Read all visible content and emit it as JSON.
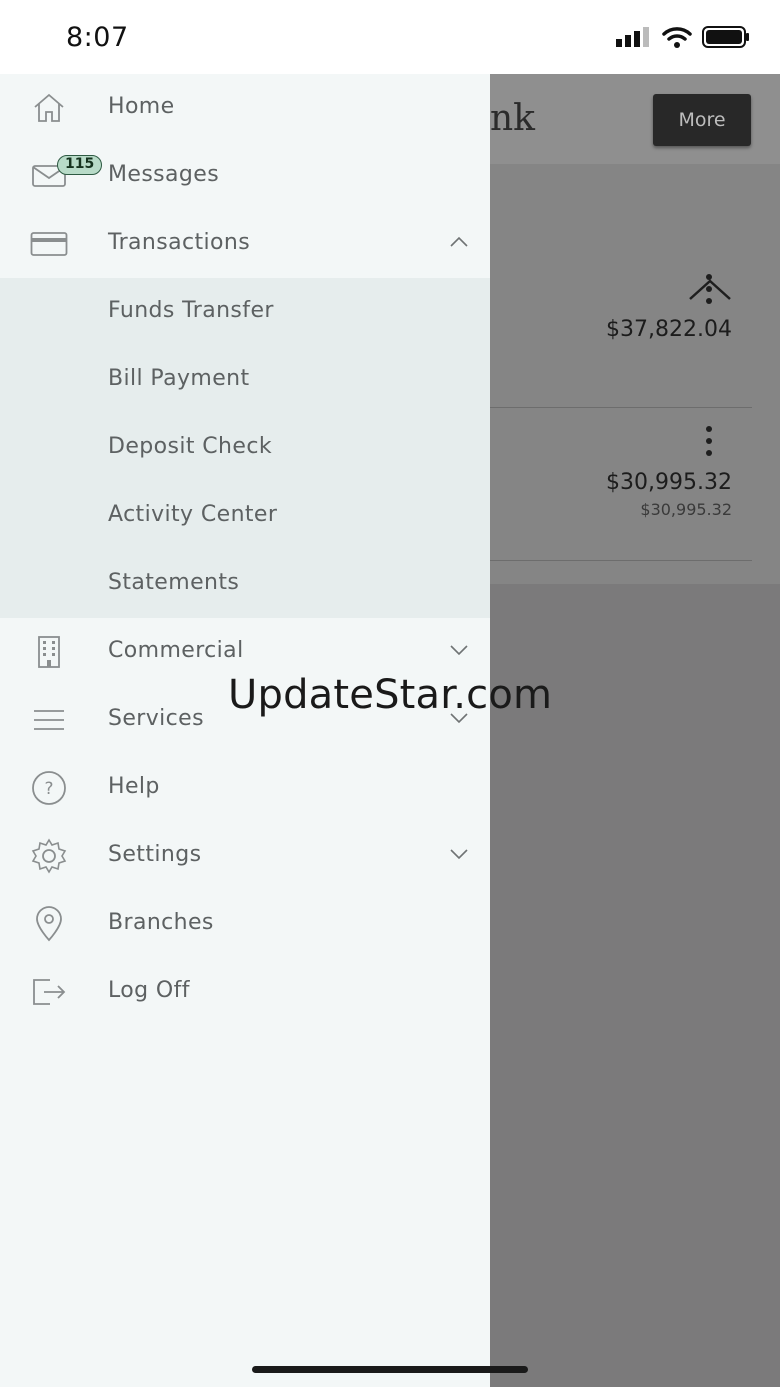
{
  "status_bar": {
    "time": "8:07"
  },
  "background_app": {
    "logo_fragment": "nk",
    "more_button": "More",
    "accounts": [
      {
        "balance": "$37,822.04",
        "sub_balance": ""
      },
      {
        "balance": "$30,995.32",
        "sub_balance": "$30,995.32"
      }
    ]
  },
  "menu": {
    "items": [
      {
        "label": "Home",
        "icon": "home-icon"
      },
      {
        "label": "Messages",
        "icon": "mail-icon",
        "badge": "115"
      },
      {
        "label": "Transactions",
        "icon": "credit-card-icon",
        "expanded": true
      },
      {
        "label": "Commercial",
        "icon": "building-icon",
        "expanded": false
      },
      {
        "label": "Services",
        "icon": "hamburger-icon",
        "expanded": false
      },
      {
        "label": "Help",
        "icon": "help-icon"
      },
      {
        "label": "Settings",
        "icon": "gear-icon",
        "expanded": false
      },
      {
        "label": "Branches",
        "icon": "location-pin-icon"
      },
      {
        "label": "Log Off",
        "icon": "log-off-icon"
      }
    ],
    "transactions_submenu": [
      {
        "label": "Funds Transfer"
      },
      {
        "label": "Bill Payment"
      },
      {
        "label": "Deposit Check"
      },
      {
        "label": "Activity Center"
      },
      {
        "label": "Statements"
      }
    ]
  },
  "watermark": "UpdateStar.com",
  "colors": {
    "drawer_bg": "#f3f7f7",
    "submenu_bg": "#e6eded",
    "menu_text": "#5d6162",
    "overlay": "#7b7a7b",
    "badge_bg": "#b8dbc8"
  }
}
